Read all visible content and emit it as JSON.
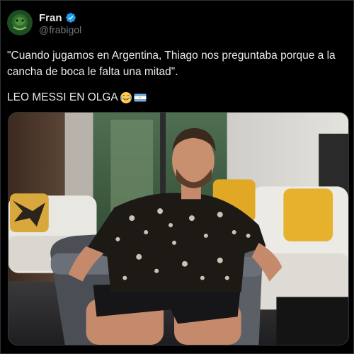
{
  "author": {
    "display_name": "Fran",
    "handle": "@frabigol",
    "verified": true,
    "avatar_icon": "avatar-image"
  },
  "tweet": {
    "text": "\"Cuando jugamos en Argentina, Thiago nos preguntaba porque a la cancha de boca le falta una mitad\".",
    "text_line2": "LEO MESSI EN OLGA",
    "emojis": [
      "face-with-tears-of-joy-icon",
      "argentina-flag-icon"
    ]
  },
  "media": {
    "type": "photo"
  },
  "colors": {
    "background": "#000000",
    "text": "#e7e9ea",
    "secondary_text": "#71767b",
    "verified_badge": "#1d9bf0",
    "border": "#2f3336"
  }
}
